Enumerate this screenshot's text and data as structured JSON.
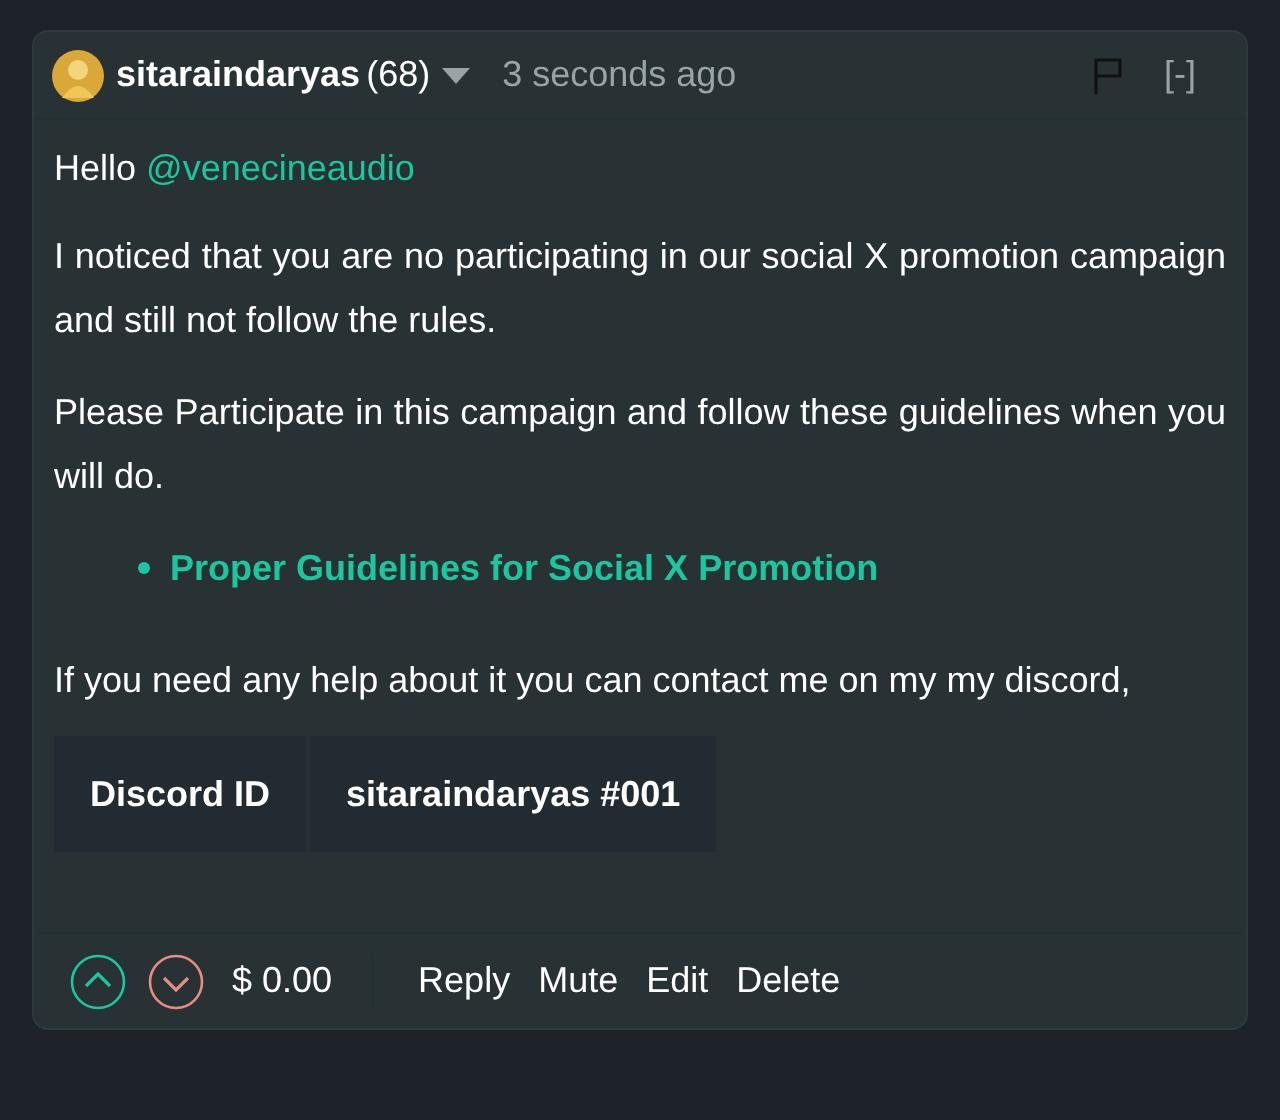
{
  "comment": {
    "author": "sitaraindaryas",
    "reputation": "(68)",
    "time": "3 seconds ago",
    "collapse": "[-]",
    "greeting": {
      "text": "Hello",
      "mention": "@venecineaudio"
    },
    "paragraphs": [
      "I noticed that you are no participating in our social X promotion campaign and still not follow the rules.",
      "Please Participate in this campaign and follow these guidelines when you will do."
    ],
    "links": [
      "Proper Guidelines for Social X Promotion"
    ],
    "closing": "If you need any help about it you can contact me on my my discord,",
    "table": {
      "cells": [
        "Discord ID",
        "sitaraindaryas #001"
      ]
    },
    "payout": "$ 0.00",
    "actions": [
      "Reply",
      "Mute",
      "Edit",
      "Delete"
    ]
  }
}
